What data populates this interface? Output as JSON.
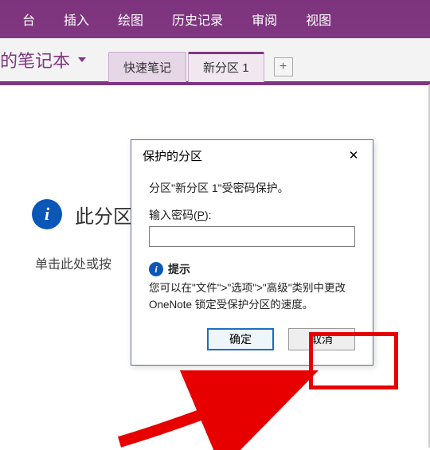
{
  "ribbon": {
    "tabs": [
      "台",
      "插入",
      "绘图",
      "历史记录",
      "审阅",
      "视图"
    ]
  },
  "notebook": {
    "title": "的笔记本"
  },
  "sections": {
    "tab1": "快速笔记",
    "tab2": "新分区 1",
    "add_label": "+"
  },
  "page": {
    "protected_heading": "此分区受",
    "click_prompt": "单击此处或按"
  },
  "dialog": {
    "title": "保护的分区",
    "section_line": "分区\"新分区 1\"受密码保护。",
    "pw_label_pre": "输入密码(",
    "pw_label_key": "P",
    "pw_label_post": "):",
    "pw_value": "",
    "tip_title": "提示",
    "tip_text": "您可以在\"文件\">\"选项\">\"高级\"类别中更改 OneNote 锁定受保护分区的速度。",
    "ok": "确定",
    "cancel": "取消",
    "close_glyph": "✕"
  },
  "info_glyph": "i"
}
